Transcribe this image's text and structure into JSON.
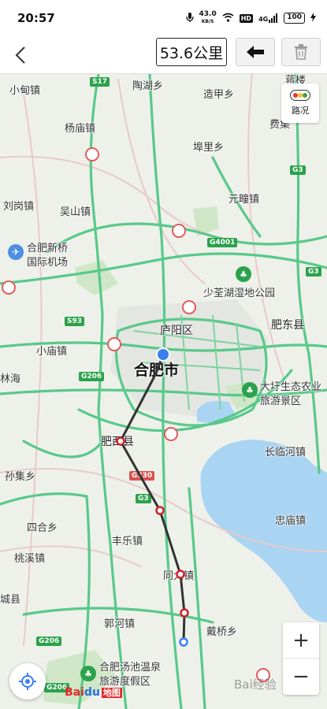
{
  "status_bar": {
    "time": "20:57",
    "net_speed": "43.0",
    "net_speed_unit": "KB/S",
    "hd_badge": "HD",
    "signal_label": "4G",
    "battery": "100"
  },
  "toolbar": {
    "distance": "53.6公里"
  },
  "map": {
    "traffic_label": "路况",
    "places": {
      "xiaodian": "小甸镇",
      "taojiang": "陶湖乡",
      "jianglou": "蒋楼",
      "zaojia": "造甲乡",
      "yangmiao": "杨庙镇",
      "feidu": "费集",
      "fuli": "埠里乡",
      "liugang": "刘岗镇",
      "wushan": "吴山镇",
      "yuanshu": "元疃镇",
      "airport_1": "合肥新桥",
      "airport_2": "国际机场",
      "shaoquan": "少荃湖湿地公园",
      "luyang": "庐阳区",
      "feidong": "肥东县",
      "xiaomiao": "小庙镇",
      "hefei": "合肥市",
      "linhai": "林海",
      "dawei_1": "大圩生态农业",
      "dawei_2": "旅游景区",
      "feixi": "肥西县",
      "changlin": "长临河镇",
      "sunji": "孙集乡",
      "zhongmiao": "忠庙镇",
      "sihe": "四合乡",
      "fengle": "丰乐镇",
      "taoxi": "桃溪镇",
      "tongda": "同大镇",
      "chengxian": "城县",
      "guohe": "郭河镇",
      "daiqiao": "戴桥乡",
      "tangchi_1": "合肥汤池温泉",
      "tangchi_2": "旅游度假区"
    },
    "shields": {
      "s17": "S17",
      "g4001": "G4001",
      "g3_a": "G3",
      "g3_b": "G3",
      "s93": "S93",
      "g206_a": "G206",
      "g206_b": "G206",
      "g206_c": "G206",
      "g330": "G330",
      "g3_c": "G3"
    },
    "logo_bai": "Bai",
    "logo_du": "du",
    "logo_map": "地图",
    "watermark": "Bai经验"
  },
  "route": {
    "points_km_note": "",
    "colors": {
      "route": "#333333",
      "node": "#d0202a",
      "start": "#3b7ff0"
    }
  }
}
